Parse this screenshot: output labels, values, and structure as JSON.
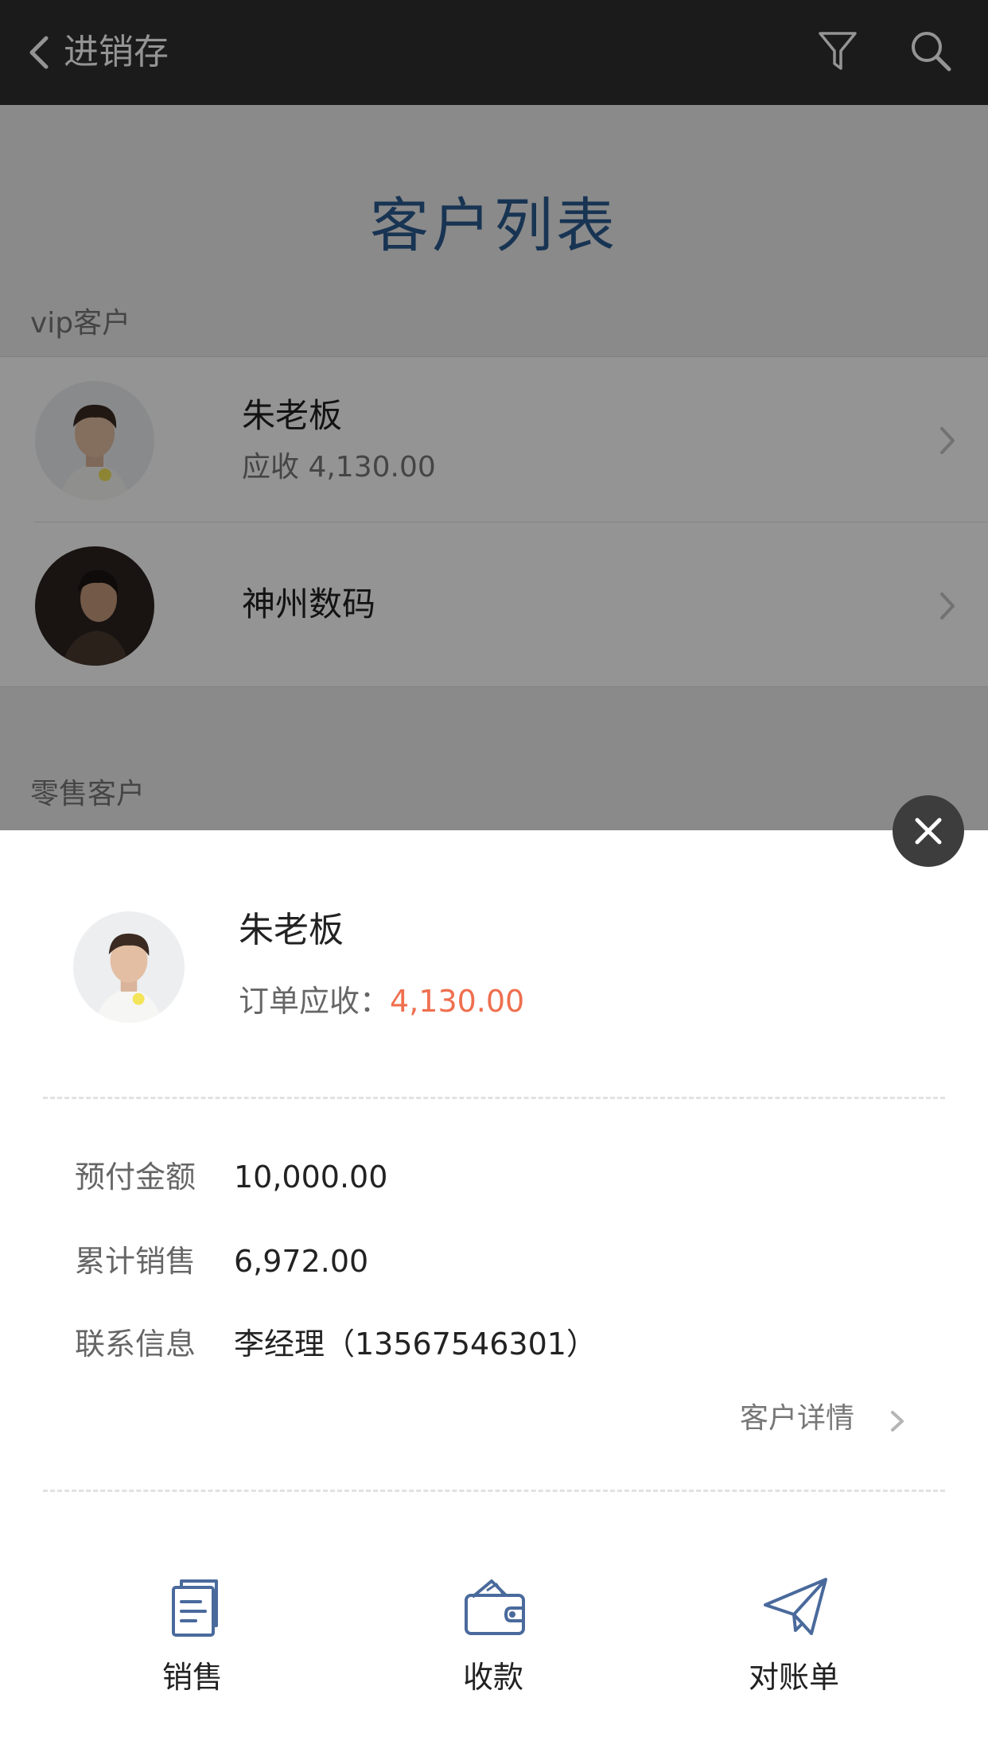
{
  "navbar": {
    "back_icon": "chevron-left-icon",
    "title": "进销存",
    "filter_icon": "filter-icon",
    "search_icon": "search-icon"
  },
  "page": {
    "heading": "客户列表",
    "sections": {
      "vip": "vip客户",
      "retail": "零售客户"
    },
    "customers": [
      {
        "name": "朱老板",
        "subtitle": "应收 4,130.00",
        "avatar": "avatar-photo"
      },
      {
        "name": "神州数码",
        "subtitle": "",
        "avatar": "avatar-photo"
      }
    ]
  },
  "sheet": {
    "close_icon": "close-icon",
    "name": "朱老板",
    "receivable_label": "订单应收：",
    "receivable_value": "4,130.00",
    "info": [
      {
        "label": "预付金额",
        "value": "10,000.00"
      },
      {
        "label": "累计销售",
        "value": "6,972.00"
      },
      {
        "label": "联系信息",
        "value": "李经理（13567546301）"
      }
    ],
    "detail_link": "客户详情",
    "actions": [
      {
        "label": "销售",
        "icon": "clipboard-icon"
      },
      {
        "label": "收款",
        "icon": "wallet-icon"
      },
      {
        "label": "对账单",
        "icon": "paper-plane-icon"
      }
    ]
  },
  "colors": {
    "navbar": "#2f2f2f",
    "heading": "#2a5a8f",
    "receivable_value": "#ef6f4f",
    "action_icon": "#4a6a9c"
  }
}
